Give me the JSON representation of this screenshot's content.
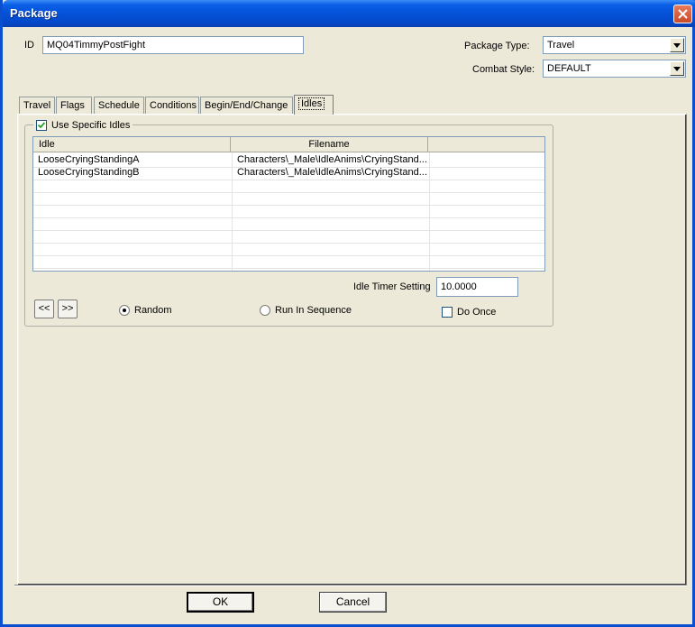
{
  "window": {
    "title": "Package"
  },
  "form": {
    "id_label": "ID",
    "id_value": "MQ04TimmyPostFight",
    "package_type_label": "Package Type:",
    "package_type_value": "Travel",
    "combat_style_label": "Combat Style:",
    "combat_style_value": "DEFAULT"
  },
  "tabs": [
    {
      "label": "Travel"
    },
    {
      "label": "Flags"
    },
    {
      "label": "Schedule"
    },
    {
      "label": "Conditions"
    },
    {
      "label": "Begin/End/Change"
    },
    {
      "label": "Idles"
    }
  ],
  "active_tab": "Idles",
  "idles": {
    "use_specific_label": "Use Specific Idles",
    "use_specific_checked": true,
    "columns": [
      "Idle",
      "Filename",
      ""
    ],
    "rows": [
      {
        "idle": "LooseCryingStandingA",
        "filename": "Characters\\_Male\\IdleAnims\\CryingStand..."
      },
      {
        "idle": "LooseCryingStandingB",
        "filename": "Characters\\_Male\\IdleAnims\\CryingStand..."
      }
    ],
    "timer_label": "Idle Timer Setting",
    "timer_value": "10.0000",
    "prev_label": "<<",
    "next_label": ">>",
    "random_label": "Random",
    "sequence_label": "Run In Sequence",
    "do_once_label": "Do Once",
    "selected_mode": "Random",
    "do_once_checked": false
  },
  "buttons": {
    "ok": "OK",
    "cancel": "Cancel"
  },
  "icons": {
    "close": "close-icon",
    "dropdown": "chevron-down-icon",
    "check": "check-icon"
  }
}
